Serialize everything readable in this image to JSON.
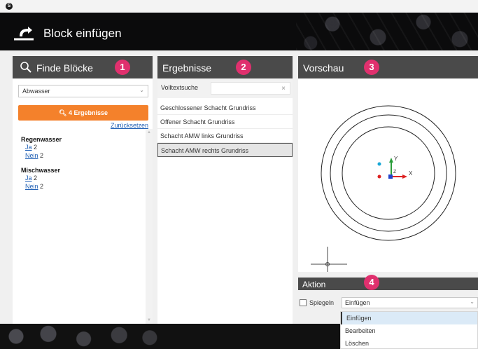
{
  "window": {
    "app_icon": "S"
  },
  "header": {
    "title": "Block einfügen",
    "icon": "insert-block-icon"
  },
  "panels": {
    "find": {
      "title": "Finde Blöcke",
      "badge": "1",
      "dropdown_value": "Abwasser",
      "results_button": "4 Ergebnisse",
      "reset_link": "Zurücksetzen",
      "facets": [
        {
          "title": "Regenwasser",
          "items": [
            {
              "link": "Ja",
              "count": "2"
            },
            {
              "link": "Nein",
              "count": "2"
            }
          ]
        },
        {
          "title": "Mischwasser",
          "items": [
            {
              "link": "Ja",
              "count": "2"
            },
            {
              "link": "Nein",
              "count": "2"
            }
          ]
        }
      ]
    },
    "results": {
      "title": "Ergebnisse",
      "badge": "2",
      "search_label": "Volltextsuche",
      "clear": "×",
      "rows": [
        "Geschlossener Schacht Grundriss",
        "Offener Schacht Grundriss",
        "Schacht AMW links Grundriss",
        "Schacht AMW rechts Grundriss"
      ],
      "selected_index": 3
    },
    "preview": {
      "title": "Vorschau",
      "badge": "3",
      "axis_x": "X",
      "axis_y": "Y",
      "axis_z": "Z"
    },
    "action": {
      "title": "Aktion",
      "badge": "4",
      "checkbox_label": "Spiegeln",
      "select_value": "Einfügen",
      "options": [
        "Einfügen",
        "Bearbeiten",
        "Löschen"
      ]
    }
  },
  "colors": {
    "accent_orange": "#f4812b",
    "badge_magenta": "#e0306e",
    "link_blue": "#1f5fb5",
    "panel_header": "#4a4a4a"
  }
}
